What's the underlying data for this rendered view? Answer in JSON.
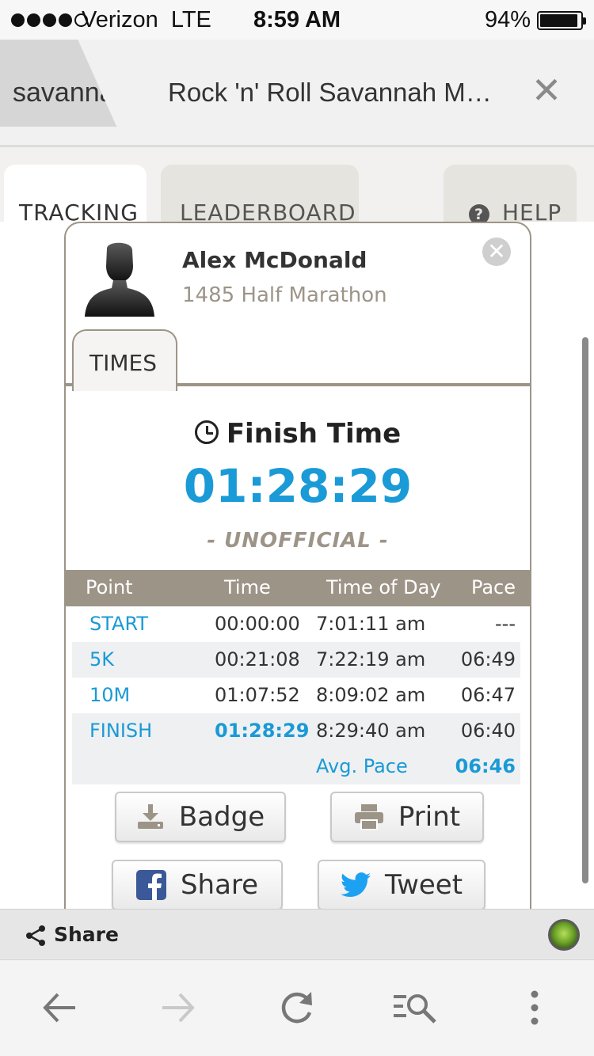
{
  "status_bar": {
    "carrier": "Verizon",
    "network": "LTE",
    "time": "8:59 AM",
    "battery_pct": "94%",
    "battery_level": 0.94
  },
  "browser": {
    "inactive_tab": "savannah",
    "active_tab_title": "Rock 'n' Roll Savannah M…",
    "share_label": "Share",
    "nav_icons": [
      "back-icon",
      "forward-icon",
      "reload-icon",
      "find-in-page-icon",
      "menu-icon"
    ]
  },
  "page_tabs": {
    "tracking": "TRACKING",
    "leaderboard": "LEADERBOARD",
    "help": "HELP"
  },
  "runner": {
    "name": "Alex McDonald",
    "subtitle": "1485 Half Marathon",
    "times_tab": "TIMES",
    "finish_label": "Finish Time",
    "finish_time": "01:28:29",
    "status": "- UNOFFICIAL -"
  },
  "splits": {
    "headers": [
      "Point",
      "Time",
      "Time of Day",
      "Pace"
    ],
    "rows": [
      {
        "point": "START",
        "time": "00:00:00",
        "tod": "7:01:11 am",
        "pace": "---"
      },
      {
        "point": "5K",
        "time": "00:21:08",
        "tod": "7:22:19 am",
        "pace": "06:49"
      },
      {
        "point": "10M",
        "time": "01:07:52",
        "tod": "8:09:02 am",
        "pace": "06:47"
      },
      {
        "point": "FINISH",
        "time": "01:28:29",
        "tod": "8:29:40 am",
        "pace": "06:40"
      }
    ],
    "avg_label": "Avg. Pace",
    "avg_value": "06:46"
  },
  "actions": {
    "badge": "Badge",
    "print": "Print",
    "share": "Share",
    "tweet": "Tweet"
  },
  "colors": {
    "accent_blue": "#1a9ad6",
    "brand_taupe": "#9d9488",
    "facebook_blue": "#3b5998",
    "twitter_blue": "#1da1f2"
  }
}
